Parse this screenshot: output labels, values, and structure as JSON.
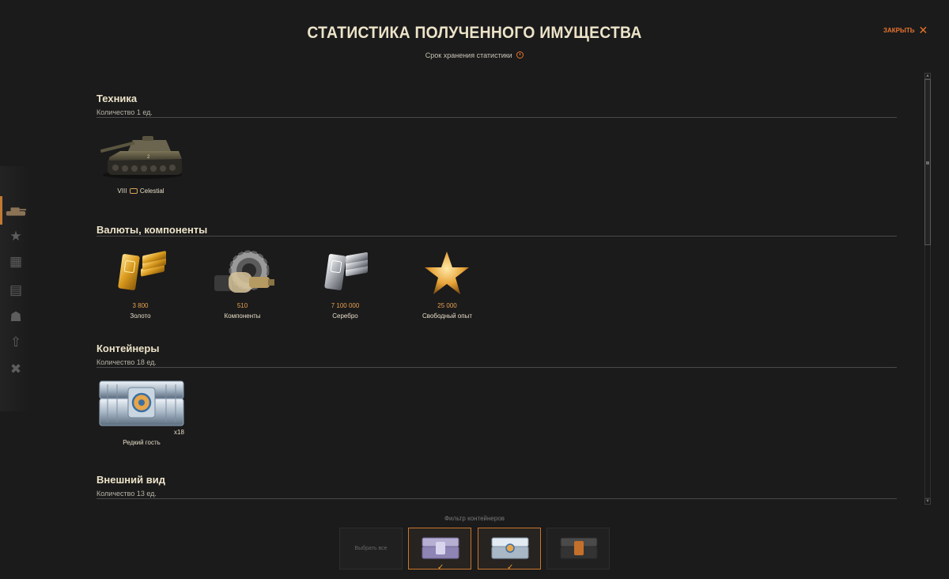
{
  "header": {
    "title": "СТАТИСТИКА ПОЛУЧЕННОГО ИМУЩЕСТВА",
    "subtitle": "Срок хранения статистики",
    "close_label": "ЗАКРЫТЬ"
  },
  "sections": {
    "vehicles": {
      "title": "Техника",
      "count": "Количество 1 ед.",
      "items": [
        {
          "tier": "VIII",
          "name": "Celestial"
        }
      ]
    },
    "currencies": {
      "title": "Валюты, компоненты",
      "items": [
        {
          "value": "3 800",
          "name": "Золото"
        },
        {
          "value": "510",
          "name": "Компоненты"
        },
        {
          "value": "7 100 000",
          "name": "Серебро"
        },
        {
          "value": "25 000",
          "name": "Свободный опыт"
        }
      ]
    },
    "containers": {
      "title": "Контейнеры",
      "count": "Количество 18 ед.",
      "items": [
        {
          "name": "Редкий гость",
          "badge": "x18"
        }
      ]
    },
    "appearance": {
      "title": "Внешний вид",
      "count": "Количество 13 ед."
    }
  },
  "filter": {
    "label": "Фильтр контейнеров",
    "select_all": "Выбрать все",
    "options": [
      {
        "name": "purple-container",
        "selected": true
      },
      {
        "name": "silver-container",
        "selected": true
      },
      {
        "name": "dark-container",
        "selected": false
      }
    ]
  },
  "colors": {
    "accent": "#e8742d",
    "value_text": "#e8a24b",
    "title_text": "#ece3c8",
    "background": "#1b1b1c"
  },
  "sidebar": {
    "icons": [
      "tank-icon",
      "crew-star-icon",
      "equipment-icon",
      "camo-icon",
      "crew-icon",
      "upgrade-arrow-icon",
      "tools-icon"
    ]
  }
}
